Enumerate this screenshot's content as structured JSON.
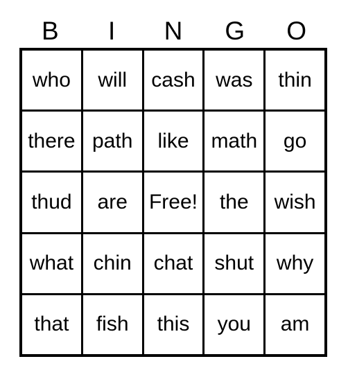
{
  "card": {
    "title_letters": [
      "B",
      "I",
      "N",
      "G",
      "O"
    ],
    "free_space_label": "Free!",
    "colors": {
      "background": "#ffffff",
      "grid_line": "#000000",
      "text": "#000000"
    },
    "rows": [
      [
        "who",
        "will",
        "cash",
        "was",
        "thin"
      ],
      [
        "there",
        "path",
        "like",
        "math",
        "go"
      ],
      [
        "thud",
        "are",
        "Free!",
        "the",
        "wish"
      ],
      [
        "what",
        "chin",
        "chat",
        "shut",
        "why"
      ],
      [
        "that",
        "fish",
        "this",
        "you",
        "am"
      ]
    ]
  }
}
